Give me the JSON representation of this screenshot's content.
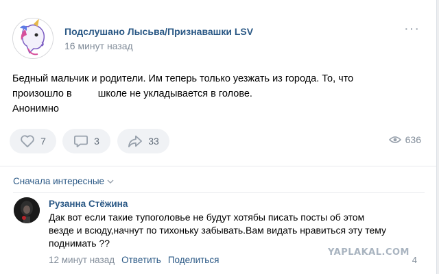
{
  "post": {
    "group_name": "Подслушано Лысьва/Признавашки LSV",
    "time": "16 минут назад",
    "text_lines": [
      "Бедный мальчик и родители. Им теперь только уезжать из города. То, что",
      "школе не укладывается в голове.",
      "Анонимно"
    ],
    "text_line2_prefix": "произошло в",
    "actions": {
      "likes": "7",
      "comments": "3",
      "shares": "33"
    },
    "views": "636",
    "more_label": "···"
  },
  "comments_section": {
    "sort_label": "Сначала интересные",
    "comment": {
      "author": "Рузанна Стёжина",
      "text_lines": [
        "Дак вот если такие тупоголовье не будут хотябы писать посты об этом",
        "везде и всюду,начнут по тихоньку забывать.Вам видать нравиться эту тему",
        "поднимать ??"
      ],
      "time": "12 минут назад",
      "reply_label": "Ответить",
      "share_label": "Поделиться",
      "likes": "4"
    }
  },
  "watermark": "YAPLAKAL.COM",
  "colors": {
    "link": "#2a5885",
    "secondary": "#818c99",
    "button_bg": "#f0f2f5",
    "page_bg": "#edeef0"
  },
  "icons": [
    "heart-icon",
    "comment-icon",
    "share-icon",
    "eye-icon",
    "chevron-down-icon",
    "more-icon"
  ]
}
